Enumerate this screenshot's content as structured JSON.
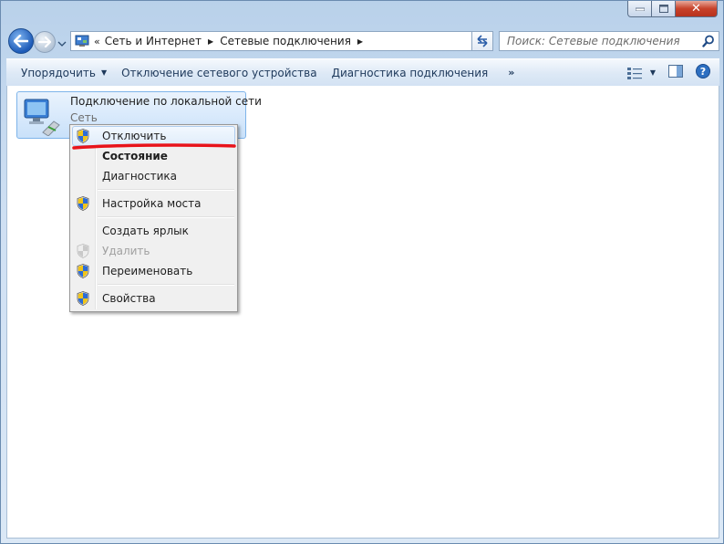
{
  "window": {
    "caption_buttons": {
      "minimize": "—",
      "maximize": "□",
      "close": "✕"
    }
  },
  "address_bar": {
    "prefix": "«",
    "breadcrumbs": [
      "Сеть и Интернет",
      "Сетевые подключения"
    ]
  },
  "search": {
    "placeholder": "Поиск: Сетевые подключения"
  },
  "toolbar": {
    "organize": "Упорядочить",
    "disable_device": "Отключение сетевого устройства",
    "diagnose": "Диагностика подключения",
    "more": "»"
  },
  "file_item": {
    "name": "Подключение по локальной сети",
    "subtitle": "Сеть"
  },
  "context_menu": {
    "items": [
      {
        "label": "Отключить",
        "icon": "shield-icon",
        "bold": false,
        "disabled": false,
        "highlighted": true
      },
      {
        "label": "Состояние",
        "icon": "",
        "bold": true,
        "disabled": false
      },
      {
        "label": "Диагностика",
        "icon": "",
        "bold": false,
        "disabled": false
      },
      {
        "label": "Настройка моста",
        "icon": "shield-icon",
        "bold": false,
        "disabled": false
      },
      {
        "label": "Создать ярлык",
        "icon": "",
        "bold": false,
        "disabled": false
      },
      {
        "label": "Удалить",
        "icon": "shield-icon",
        "bold": false,
        "disabled": true
      },
      {
        "label": "Переименовать",
        "icon": "shield-icon",
        "bold": false,
        "disabled": false
      },
      {
        "label": "Свойства",
        "icon": "shield-icon",
        "bold": false,
        "disabled": false
      }
    ]
  },
  "colors": {
    "annotation_red": "#e8141b",
    "selection_blue": "#c9e1fa",
    "toolbar_text": "#1e395b"
  }
}
